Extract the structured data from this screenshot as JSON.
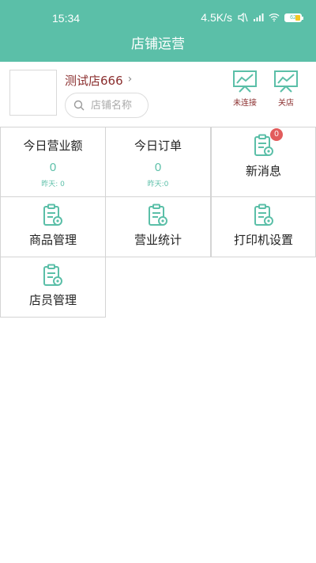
{
  "status_bar": {
    "time": "15:34",
    "network_speed": "4.5K/s",
    "battery_level": "62",
    "icons": [
      "mute-icon",
      "signal-icon",
      "wifi-icon",
      "battery-icon"
    ]
  },
  "header": {
    "title": "店铺运营"
  },
  "store": {
    "name": "测试店666",
    "search_placeholder": "店铺名称",
    "actions": [
      {
        "label": "未连接",
        "icon": "monitor-chart-icon"
      },
      {
        "label": "关店",
        "icon": "monitor-chart-icon"
      }
    ]
  },
  "stats": {
    "revenue": {
      "label": "今日营业额",
      "value": "0",
      "yesterday": "昨天: 0"
    },
    "orders": {
      "label": "今日订单",
      "value": "0",
      "yesterday": "昨天:0"
    }
  },
  "menu": {
    "messages": {
      "label": "新消息",
      "badge": "0",
      "icon": "clipboard-gear-icon"
    },
    "products": {
      "label": "商品管理",
      "icon": "clipboard-gear-icon"
    },
    "statistics": {
      "label": "营业统计",
      "icon": "clipboard-gear-icon"
    },
    "printer": {
      "label": "打印机设置",
      "icon": "clipboard-gear-icon"
    },
    "staff": {
      "label": "店员管理",
      "icon": "clipboard-gear-icon"
    }
  },
  "colors": {
    "primary": "#5bbfa8",
    "accent_text": "#8b2f2f",
    "badge": "#e25c5c"
  }
}
